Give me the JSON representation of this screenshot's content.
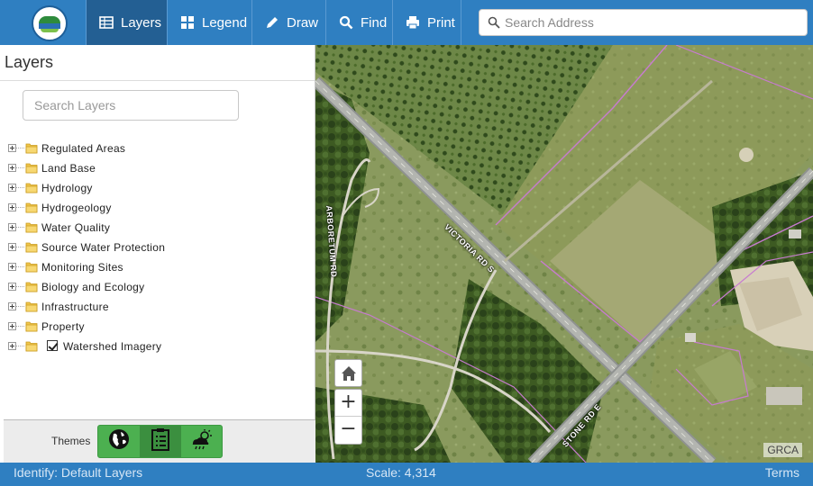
{
  "toolbar": {
    "buttons": [
      {
        "label": "Layers",
        "icon": "table-icon"
      },
      {
        "label": "Legend",
        "icon": "grid-icon"
      },
      {
        "label": "Draw",
        "icon": "pencil-icon"
      },
      {
        "label": "Find",
        "icon": "search-icon"
      },
      {
        "label": "Print",
        "icon": "printer-icon"
      }
    ],
    "search_placeholder": "Search Address",
    "active": "Layers"
  },
  "panel": {
    "title": "Layers",
    "search_placeholder": "Search Layers",
    "items": [
      {
        "label": "Regulated Areas"
      },
      {
        "label": "Land Base"
      },
      {
        "label": "Hydrology"
      },
      {
        "label": "Hydrogeology"
      },
      {
        "label": "Water Quality"
      },
      {
        "label": "Source Water Protection"
      },
      {
        "label": "Monitoring Sites"
      },
      {
        "label": "Biology and Ecology"
      },
      {
        "label": "Infrastructure"
      },
      {
        "label": "Property"
      },
      {
        "label": "Watershed Imagery",
        "checked": true
      }
    ],
    "themes_label": "Themes",
    "themes": [
      {
        "icon": "globe-icon"
      },
      {
        "icon": "clipboard-icon",
        "selected": true
      },
      {
        "icon": "weather-icon"
      }
    ]
  },
  "map": {
    "attribution": "GRCA",
    "road_labels": [
      "VICTORIA RD S",
      "ARBORETUM RD",
      "STONE RD E"
    ],
    "zoom_in": "+",
    "zoom_out": "−"
  },
  "status": {
    "identify": "Identify: Default Layers",
    "scale": "Scale: 4,314",
    "terms": "Terms"
  },
  "colors": {
    "toolbar": "#2f7fc1",
    "toolbar_active": "#235f93",
    "theme_green": "#4cb050"
  }
}
